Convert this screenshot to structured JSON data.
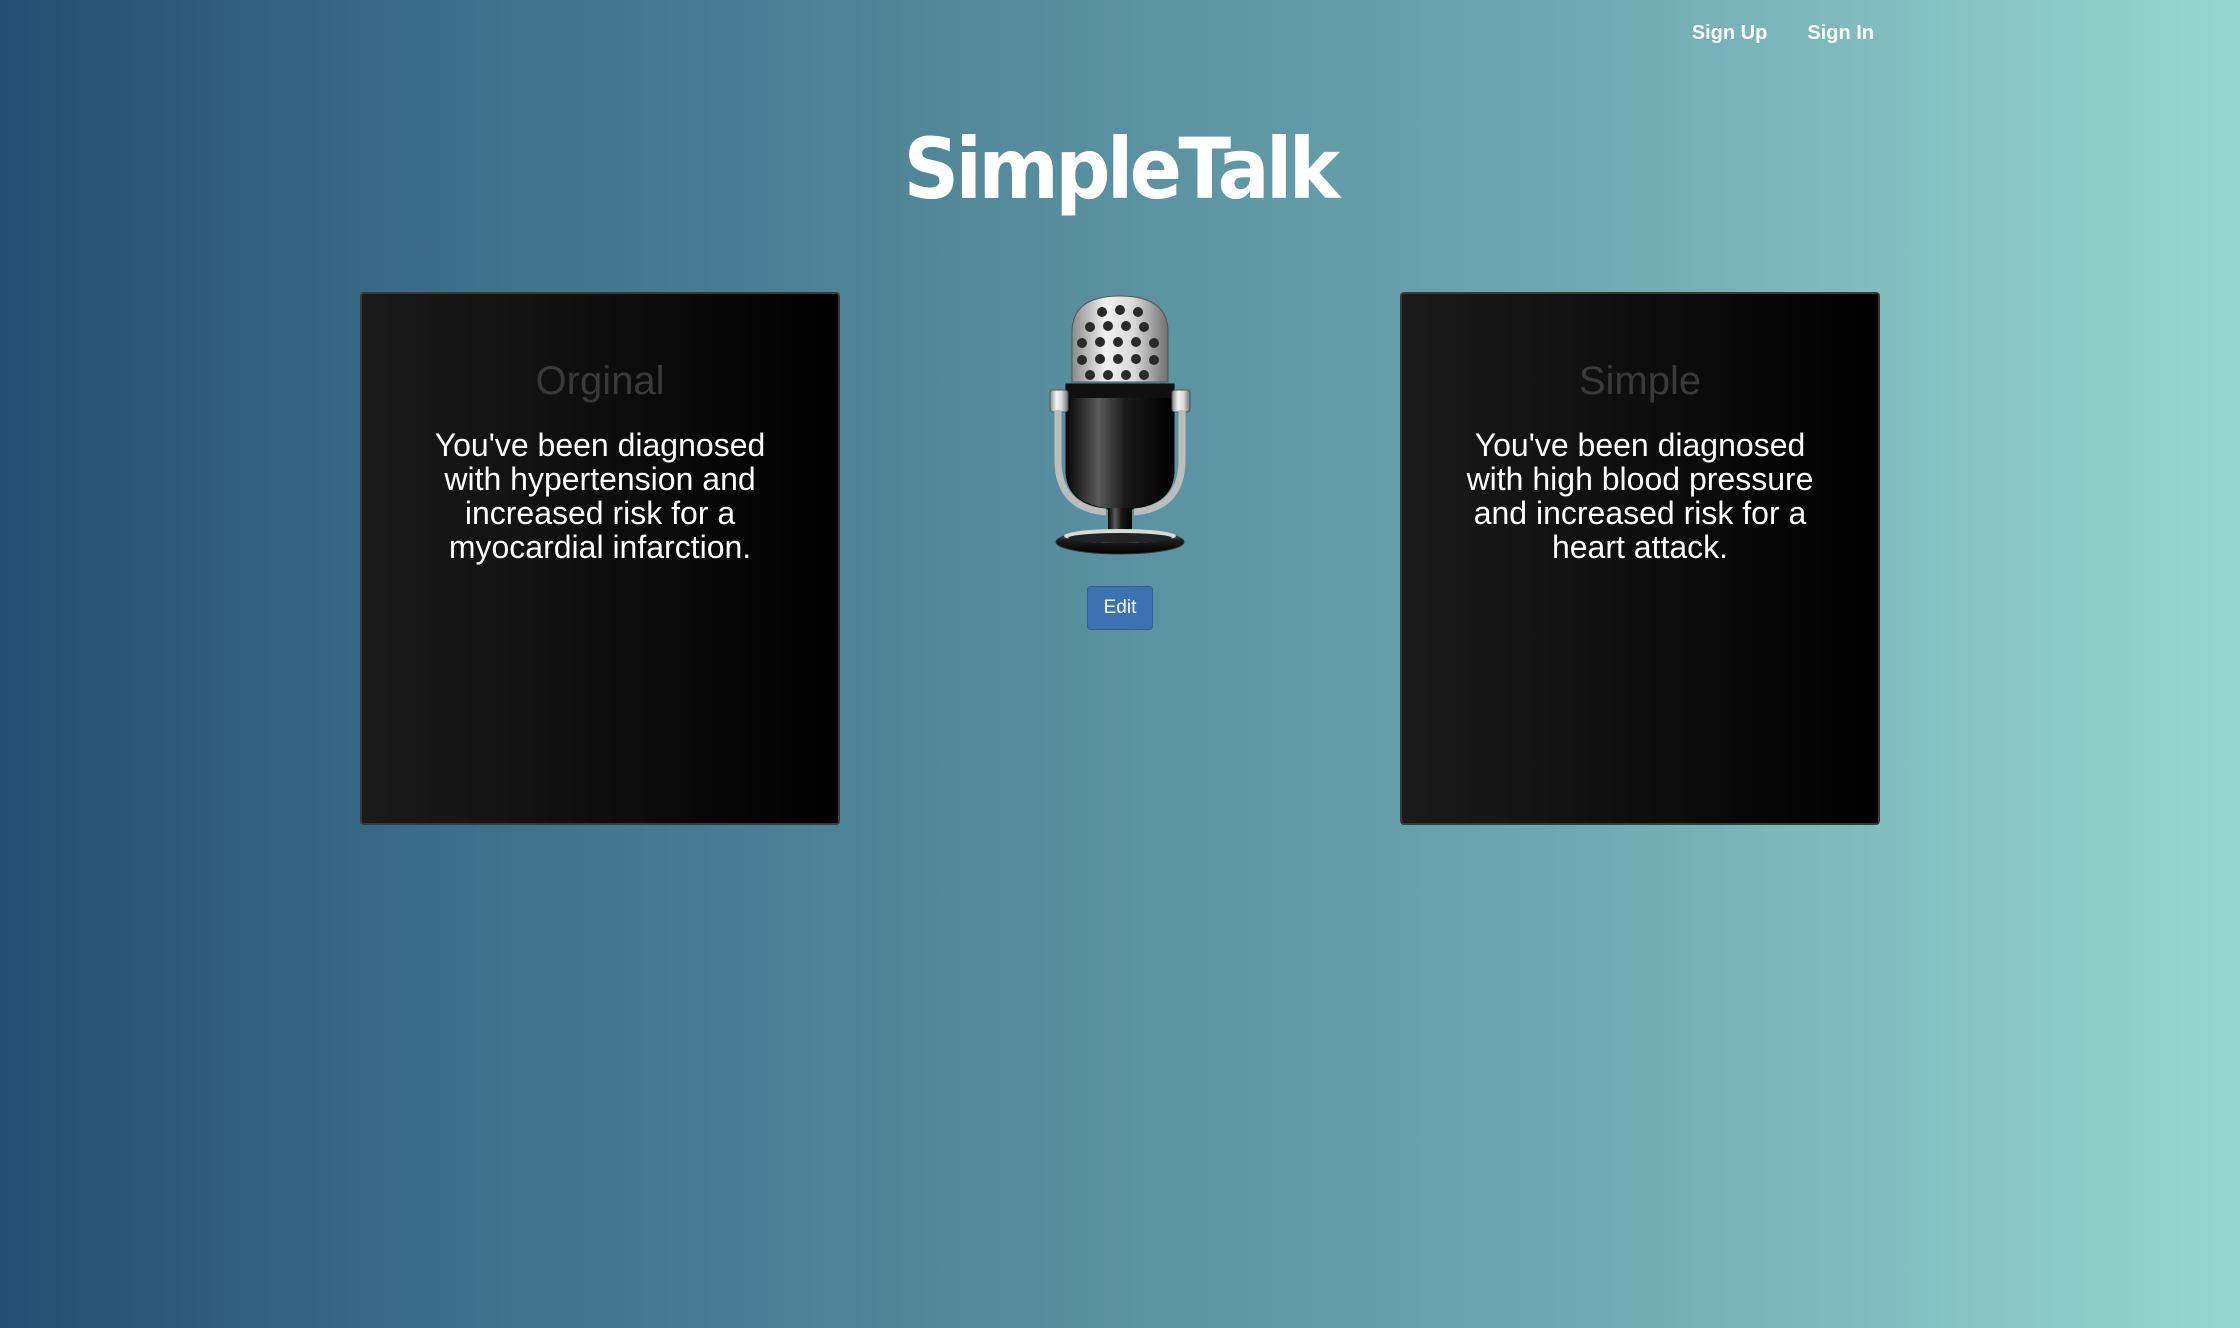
{
  "nav": {
    "sign_up": "Sign Up",
    "sign_in": "Sign In"
  },
  "brand": {
    "title": "SimpleTalk"
  },
  "original_panel": {
    "title": "Orginal",
    "text": "You've been diagnosed with hypertension and increased risk for a myocardial infarction."
  },
  "simple_panel": {
    "title": "Simple",
    "text": "You've been diagnosed with high blood pressure and increased risk for a heart attack."
  },
  "microphone": {
    "icon": "microphone-icon"
  },
  "edit_button": {
    "label": "Edit"
  },
  "colors": {
    "background_start": "#234d72",
    "background_end": "#97d6cf",
    "panel_background": "#000000",
    "button_blue": "#3b72b4"
  }
}
